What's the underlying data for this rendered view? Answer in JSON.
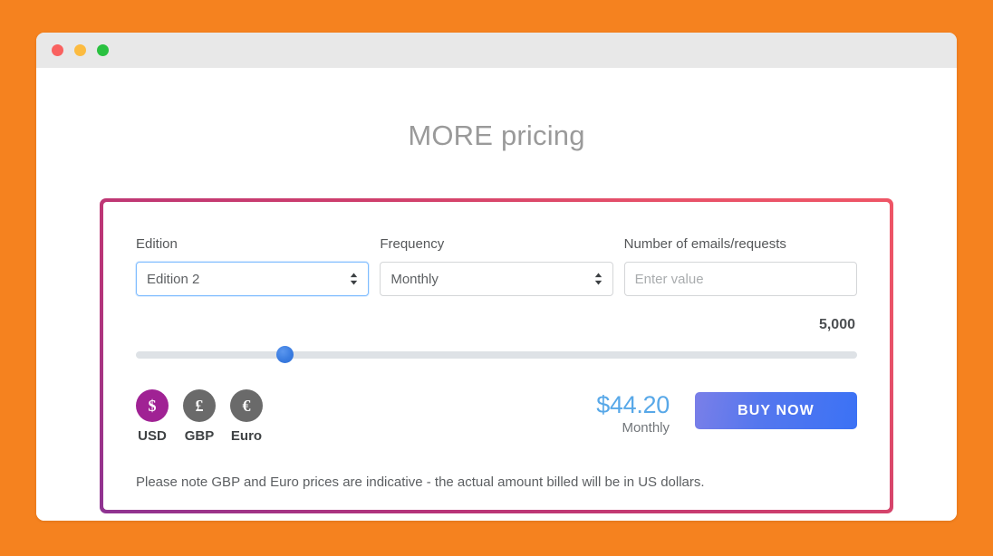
{
  "background_color": "#f5821f",
  "window": {
    "traffic_lights": [
      {
        "name": "close",
        "color": "#f9615f"
      },
      {
        "name": "minimize",
        "color": "#fcbb40"
      },
      {
        "name": "maximize",
        "color": "#2ac140"
      }
    ]
  },
  "page": {
    "title": "MORE pricing"
  },
  "panel": {
    "border_gradient_from": "#8e3392",
    "border_gradient_to": "#ee5566"
  },
  "form": {
    "edition": {
      "label": "Edition",
      "value": "Edition 2",
      "focused": true
    },
    "frequency": {
      "label": "Frequency",
      "value": "Monthly",
      "focused": false
    },
    "number": {
      "label": "Number of emails/requests",
      "value": "",
      "placeholder": "Enter value"
    }
  },
  "slider": {
    "value_label": "5,000",
    "value": 5000,
    "percent": 20.6,
    "track_color": "#dee2e6",
    "thumb_color": "#3a7ce0"
  },
  "currencies": [
    {
      "code": "USD",
      "symbol": "$",
      "active": true,
      "color": "#a02294"
    },
    {
      "code": "GBP",
      "symbol": "£",
      "active": false,
      "color": "#6a6a6a"
    },
    {
      "code": "Euro",
      "symbol": "€",
      "active": false,
      "color": "#6a6a6a"
    }
  ],
  "price": {
    "amount": "$44.20",
    "period": "Monthly",
    "color": "#58a8e8"
  },
  "buy": {
    "label": "BUY NOW",
    "gradient_from": "#7a7fe8",
    "gradient_to": "#3b72f5"
  },
  "note": "Please note GBP and Euro prices are indicative - the actual amount billed will be in US dollars."
}
